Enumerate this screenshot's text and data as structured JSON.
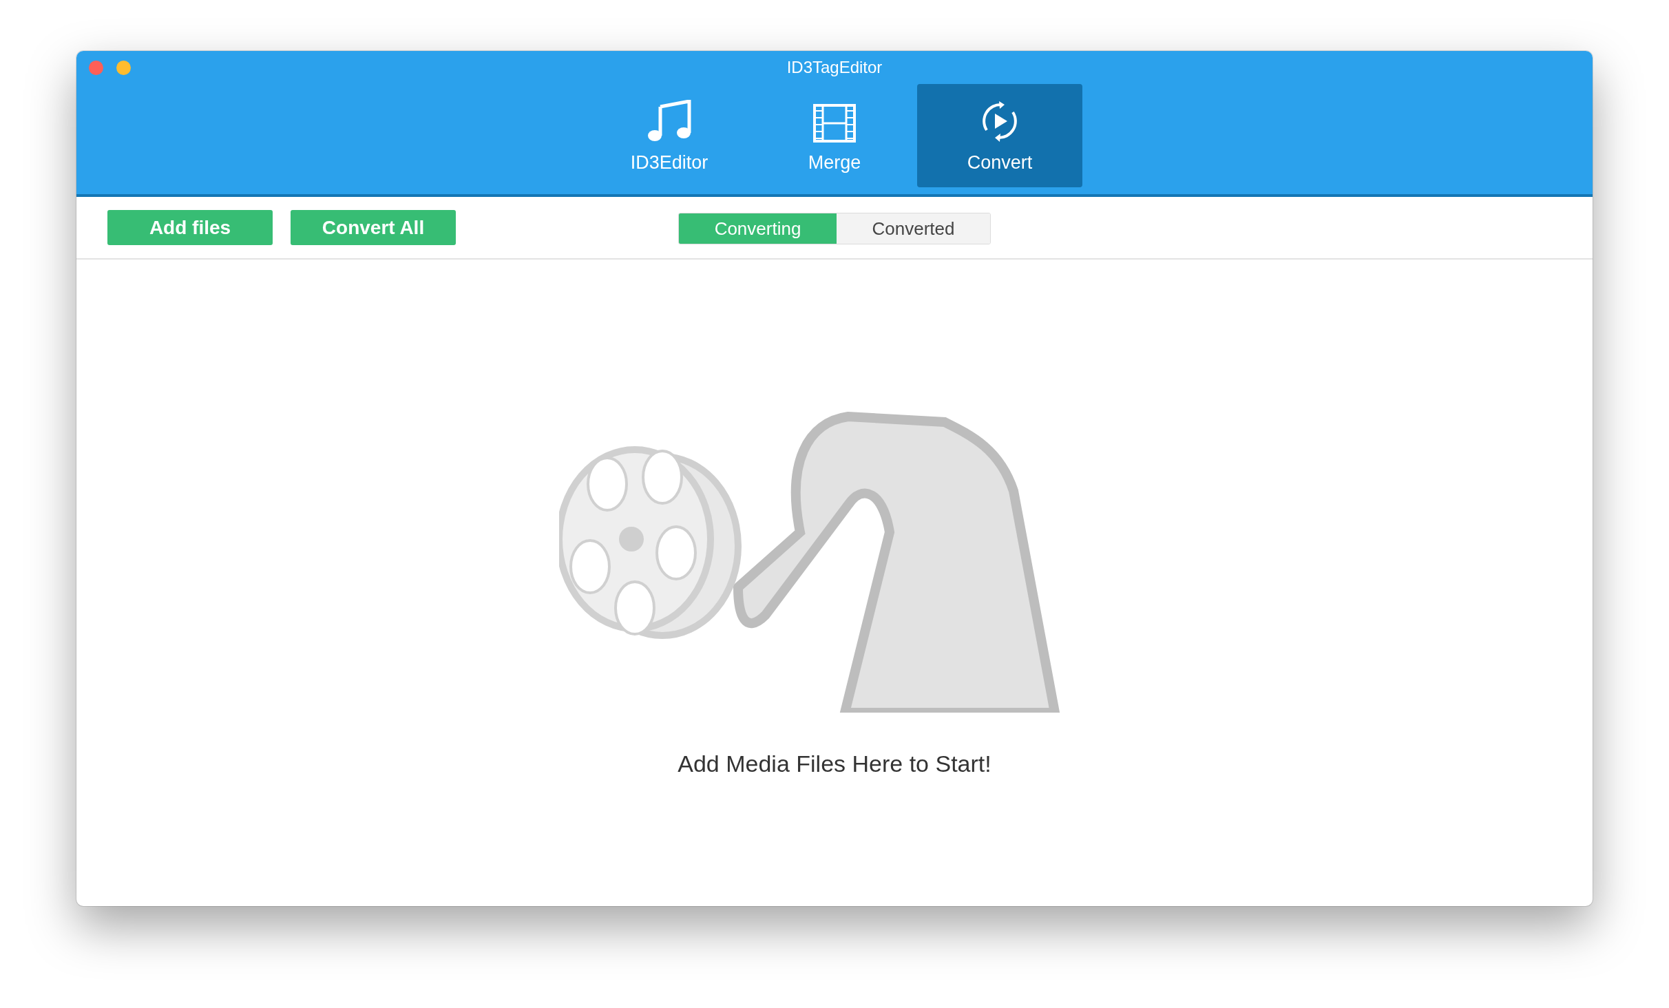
{
  "window": {
    "title": "ID3TagEditor"
  },
  "tabs": [
    {
      "label": "ID3Editor",
      "kind": "music",
      "selected": false
    },
    {
      "label": "Merge",
      "kind": "film",
      "selected": false
    },
    {
      "label": "Convert",
      "kind": "convert",
      "selected": true
    }
  ],
  "toolbar": {
    "buttons": [
      "Add files",
      "Convert All"
    ],
    "segments": [
      {
        "label": "Converting",
        "selected": true
      },
      {
        "label": "Converted",
        "selected": false
      }
    ]
  },
  "empty_state": {
    "message": "Add Media Files Here to Start!"
  }
}
